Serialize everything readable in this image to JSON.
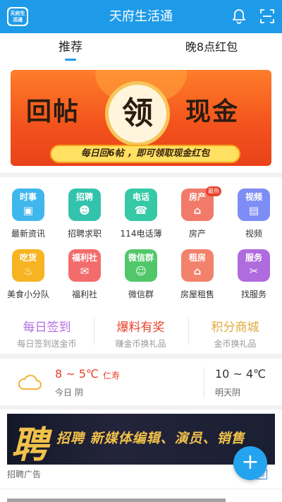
{
  "app": {
    "title": "天府生活通",
    "logo_text": "天府生活通"
  },
  "header": {
    "bell_icon": "bell-icon",
    "scan_icon": "scan-icon"
  },
  "tabs": [
    {
      "label": "推荐",
      "active": true
    },
    {
      "label": "晚8点红包",
      "active": false
    }
  ],
  "banner": {
    "left_text": "回帖",
    "center_text": "领",
    "right_text": "现金",
    "strip_text": "每日回6帖 ，即可领取现金红包"
  },
  "grid": [
    {
      "icon_text": "时事",
      "glyph": "▣",
      "label": "最新资讯",
      "color": "#3fb7ec"
    },
    {
      "icon_text": "招聘",
      "glyph": "☻",
      "label": "招聘求职",
      "color": "#33c3ad"
    },
    {
      "icon_text": "电话",
      "glyph": "☎",
      "label": "114电话薄",
      "color": "#36c9a6"
    },
    {
      "icon_text": "房产",
      "glyph": "⌂",
      "label": "房产",
      "color": "#f27a6a",
      "badge": "最热"
    },
    {
      "icon_text": "视频",
      "glyph": "▤",
      "label": "视频",
      "color": "#7d8df5"
    },
    {
      "icon_text": "吃货",
      "glyph": "♨",
      "label": "美食小分队",
      "color": "#f6b422"
    },
    {
      "icon_text": "福利社",
      "glyph": "✉",
      "label": "福利社",
      "color": "#f36c6c"
    },
    {
      "icon_text": "微信群",
      "glyph": "☺",
      "label": "微信群",
      "color": "#52c76a"
    },
    {
      "icon_text": "租房",
      "glyph": "⌂",
      "label": "房屋租售",
      "color": "#f2826c"
    },
    {
      "icon_text": "服务",
      "glyph": "✂",
      "label": "找服务",
      "color": "#b06bde"
    }
  ],
  "promos": [
    {
      "title": "每日签到",
      "sub": "每日签到送金币",
      "color": "#b36ee0"
    },
    {
      "title": "爆料有奖",
      "sub": "赚金币换礼品",
      "color": "#e8412b"
    },
    {
      "title": "积分商城",
      "sub": "金币换礼品",
      "color": "#e0a93a"
    }
  ],
  "weather": {
    "today_temp": "8 ~ 5℃",
    "city": "仁寿",
    "today_desc": "今日 阴",
    "tomorrow_temp": "10 ~ 4℃",
    "tomorrow_desc": "明天阴"
  },
  "ad": {
    "big_char": "聘",
    "text": "招聘  新媒体编辑、演员、销售",
    "label": "招聘广告",
    "tag": "告"
  },
  "fab": {
    "label": "+"
  }
}
